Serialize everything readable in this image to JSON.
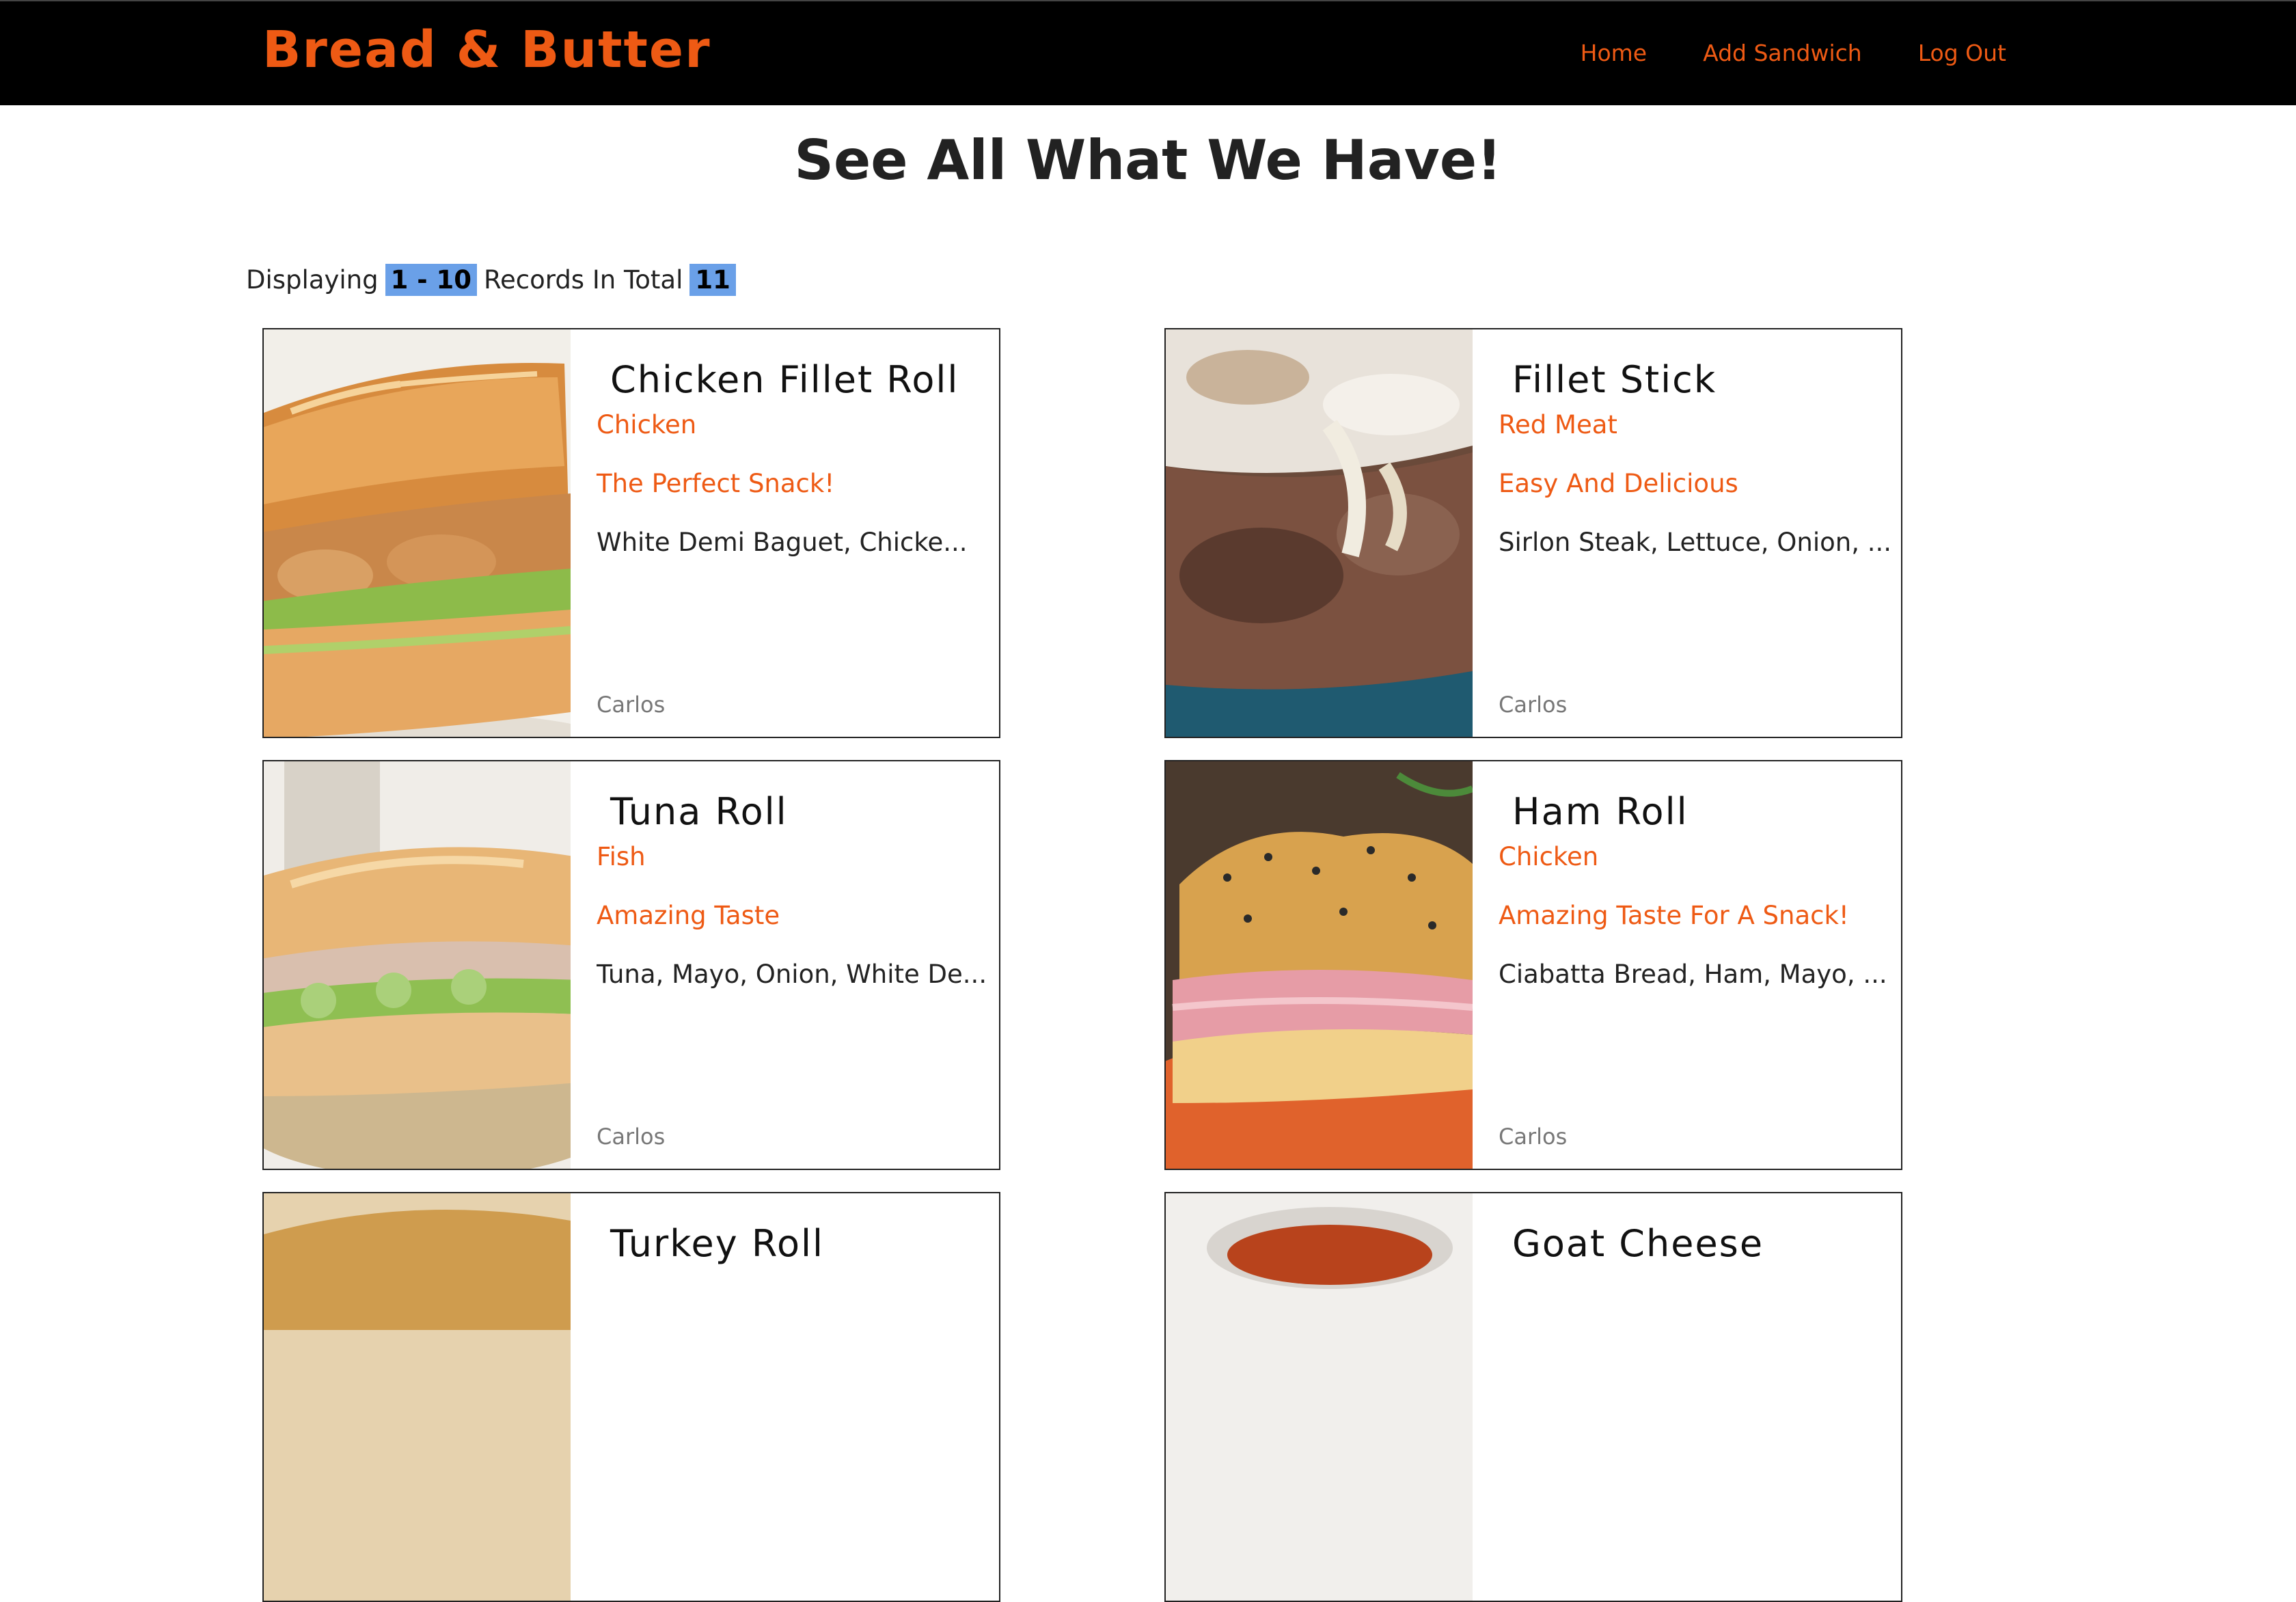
{
  "brand": "Bread & Butter",
  "nav": {
    "home": "Home",
    "add_sandwich": "Add Sandwich",
    "log_out": "Log Out"
  },
  "heading": "See All What We Have!",
  "records": {
    "prefix": "Displaying",
    "range": "1 - 10",
    "middle": "Records In Total",
    "total": "11"
  },
  "sandwiches": [
    {
      "name": "Chicken Fillet Roll",
      "category": "Chicken",
      "tagline": "The Perfect Snack!",
      "ingredients": "White Demi Baguet, Chicke...",
      "author": "Carlos"
    },
    {
      "name": "Fillet Stick",
      "category": "Red Meat",
      "tagline": "Easy And Delicious",
      "ingredients": "Sirlon Steak, Lettuce, Onion, ...",
      "author": "Carlos"
    },
    {
      "name": "Tuna Roll",
      "category": "Fish",
      "tagline": "Amazing Taste",
      "ingredients": "Tuna, Mayo, Onion, White De...",
      "author": "Carlos"
    },
    {
      "name": "Ham Roll",
      "category": "Chicken",
      "tagline": "Amazing Taste For A Snack!",
      "ingredients": "Ciabatta Bread, Ham, Mayo, ...",
      "author": "Carlos"
    },
    {
      "name": "Turkey Roll"
    },
    {
      "name": "Goat Cheese"
    }
  ],
  "colors": {
    "accent": "#ee5a14",
    "navbar_bg": "#000000",
    "highlight": "#6aa0e8"
  }
}
